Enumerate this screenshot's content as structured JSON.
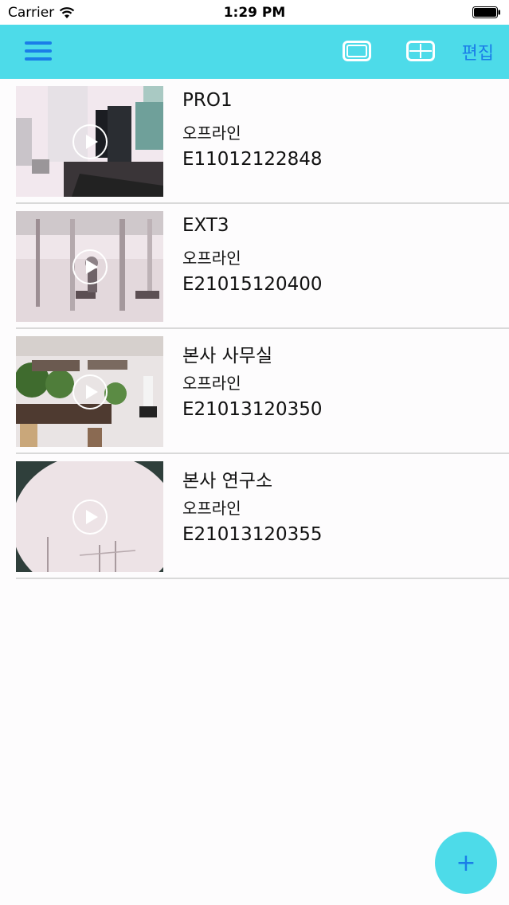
{
  "status_bar": {
    "carrier": "Carrier",
    "time": "1:29 PM"
  },
  "toolbar": {
    "edit_label": "편집",
    "icons": [
      "menu-icon",
      "single-view-icon",
      "quad-view-icon"
    ],
    "accent_color": "#4ddbe9",
    "link_color": "#1a7de8"
  },
  "cameras": [
    {
      "name": "PRO1",
      "status": "오프라인",
      "serial": "E11012122848"
    },
    {
      "name": "EXT3",
      "status": "오프라인",
      "serial": "E21015120400"
    },
    {
      "name": "본사 사무실",
      "status": "오프라인",
      "serial": "E21013120350"
    },
    {
      "name": "본사 연구소",
      "status": "오프라인",
      "serial": "E21013120355"
    }
  ],
  "fab": {
    "label": "+"
  }
}
